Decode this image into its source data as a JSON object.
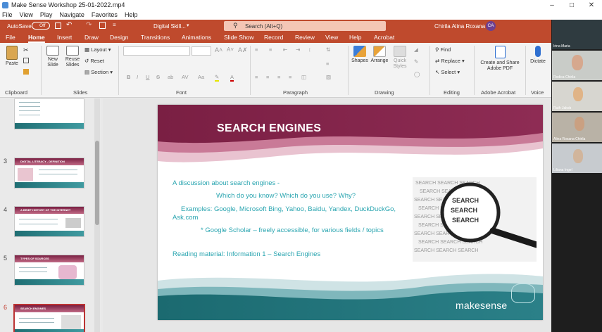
{
  "window": {
    "title": "Make Sense Workshop 25-01-2022.mp4",
    "menu": [
      "File",
      "View",
      "Play",
      "Navigate",
      "Favorites",
      "Help"
    ]
  },
  "ppt": {
    "autosave_label": "AutoSave",
    "autosave_state": "Off",
    "doc_name": "Digital Skill...",
    "search_placeholder": "Search (Alt+Q)",
    "user_name": "Chirila Alina Roxana",
    "user_initials": "CA",
    "tabs": [
      "File",
      "Home",
      "Insert",
      "Draw",
      "Design",
      "Transitions",
      "Animations",
      "Slide Show",
      "Record",
      "Review",
      "View",
      "Help",
      "Acrobat"
    ],
    "active_tab": "Home",
    "ribbon": {
      "clipboard": {
        "paste": "Paste",
        "label": "Clipboard"
      },
      "slides": {
        "new_slide": "New Slide",
        "reuse_slides": "Reuse Slides",
        "layout": "Layout",
        "reset": "Reset",
        "section": "Section",
        "label": "Slides"
      },
      "font": {
        "label": "Font"
      },
      "paragraph": {
        "label": "Paragraph"
      },
      "drawing": {
        "shapes": "Shapes",
        "arrange": "Arrange",
        "quick_styles": "Quick Styles",
        "label": "Drawing"
      },
      "editing": {
        "find": "Find",
        "replace": "Replace",
        "select": "Select",
        "label": "Editing"
      },
      "acrobat": {
        "create": "Create and Share Adobe PDF",
        "label": "Adobe Acrobat"
      },
      "voice": {
        "dictate": "Dictate",
        "label": "Voice"
      }
    }
  },
  "thumbnails": [
    {
      "num": "3",
      "title": "DIGITAL LITERACY - DEFINITION"
    },
    {
      "num": "4",
      "title": "A BRIEF HISTORY OF THE INTERNET"
    },
    {
      "num": "5",
      "title": "TYPES OF SOURCES"
    },
    {
      "num": "6",
      "title": "SEARCH ENGINES"
    }
  ],
  "slide": {
    "title": "SEARCH ENGINES",
    "line1": "A discussion about search engines -",
    "line2": "Which do you know? Which do you use? Why?",
    "line3": "Examples: Google, Microsoft Bing, Yahoo, Baidu, Yandex, DuckDuckGo,",
    "line4": "Ask.com",
    "line5": "* Google Scholar – freely accessible, for various fields / topics",
    "line6": "Reading material: Information 1 – Search Engines",
    "image_word": "SEARCH",
    "brand": "makesense"
  },
  "participants": [
    {
      "name": "Irina Maria"
    },
    {
      "name": "Rodica Chirila"
    },
    {
      "name": "Ruth Jakob"
    },
    {
      "name": "Alina Roxana Chirila"
    },
    {
      "name": "Liliana Ingel"
    }
  ],
  "colors": {
    "ribbon": "#bf4a2d",
    "slide_wine": "#7b2043",
    "slide_teal": "#1f6e73",
    "slide_text": "#2aa5b0"
  }
}
